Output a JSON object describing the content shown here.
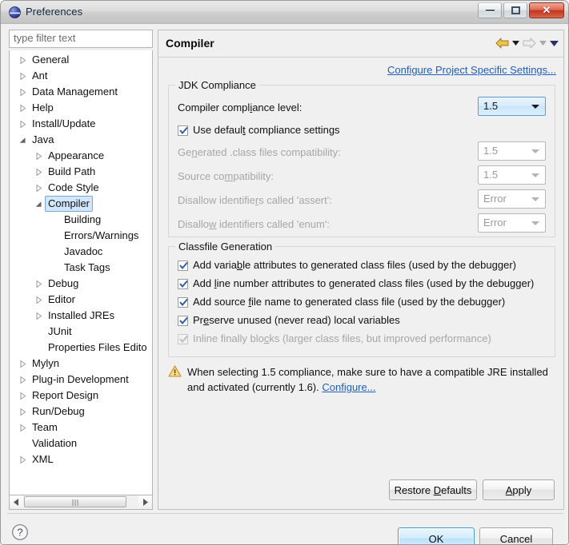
{
  "window": {
    "title": "Preferences",
    "icon": "eclipse-sphere-icon",
    "controls": {
      "minimize": "Minimize",
      "maximize": "Maximize",
      "close": "Close"
    }
  },
  "sidebar": {
    "filter": {
      "placeholder": "type filter text",
      "value": ""
    },
    "items": [
      {
        "label": "General",
        "depth": 0,
        "twisty": "collapsed",
        "selected": false
      },
      {
        "label": "Ant",
        "depth": 0,
        "twisty": "collapsed",
        "selected": false
      },
      {
        "label": "Data Management",
        "depth": 0,
        "twisty": "collapsed",
        "selected": false
      },
      {
        "label": "Help",
        "depth": 0,
        "twisty": "collapsed",
        "selected": false
      },
      {
        "label": "Install/Update",
        "depth": 0,
        "twisty": "collapsed",
        "selected": false
      },
      {
        "label": "Java",
        "depth": 0,
        "twisty": "expanded",
        "selected": false
      },
      {
        "label": "Appearance",
        "depth": 1,
        "twisty": "collapsed",
        "selected": false
      },
      {
        "label": "Build Path",
        "depth": 1,
        "twisty": "collapsed",
        "selected": false
      },
      {
        "label": "Code Style",
        "depth": 1,
        "twisty": "collapsed",
        "selected": false
      },
      {
        "label": "Compiler",
        "depth": 1,
        "twisty": "expanded",
        "selected": true
      },
      {
        "label": "Building",
        "depth": 2,
        "twisty": "none",
        "selected": false
      },
      {
        "label": "Errors/Warnings",
        "depth": 2,
        "twisty": "none",
        "selected": false
      },
      {
        "label": "Javadoc",
        "depth": 2,
        "twisty": "none",
        "selected": false
      },
      {
        "label": "Task Tags",
        "depth": 2,
        "twisty": "none",
        "selected": false
      },
      {
        "label": "Debug",
        "depth": 1,
        "twisty": "collapsed",
        "selected": false
      },
      {
        "label": "Editor",
        "depth": 1,
        "twisty": "collapsed",
        "selected": false
      },
      {
        "label": "Installed JREs",
        "depth": 1,
        "twisty": "collapsed",
        "selected": false
      },
      {
        "label": "JUnit",
        "depth": 1,
        "twisty": "none",
        "selected": false
      },
      {
        "label": "Properties Files Edito",
        "depth": 1,
        "twisty": "none",
        "selected": false
      },
      {
        "label": "Mylyn",
        "depth": 0,
        "twisty": "collapsed",
        "selected": false
      },
      {
        "label": "Plug-in Development",
        "depth": 0,
        "twisty": "collapsed",
        "selected": false
      },
      {
        "label": "Report Design",
        "depth": 0,
        "twisty": "collapsed",
        "selected": false
      },
      {
        "label": "Run/Debug",
        "depth": 0,
        "twisty": "collapsed",
        "selected": false
      },
      {
        "label": "Team",
        "depth": 0,
        "twisty": "collapsed",
        "selected": false
      },
      {
        "label": "Validation",
        "depth": 0,
        "twisty": "none",
        "selected": false
      },
      {
        "label": "XML",
        "depth": 0,
        "twisty": "collapsed",
        "selected": false
      }
    ]
  },
  "page": {
    "title": "Compiler",
    "nav": {
      "back": "back-arrow-icon",
      "back_menu": "back-history-dropdown-icon",
      "forward": "forward-arrow-icon",
      "forward_menu": "forward-history-dropdown-icon",
      "view_menu": "view-menu-dropdown-icon"
    },
    "project_settings_link": "Configure Project Specific Settings...",
    "jdk_group": {
      "legend": "JDK Compliance",
      "compliance_level": {
        "label": "Compiler compliance level:",
        "value": "1.5",
        "enabled": true
      },
      "use_defaults": {
        "label": "Use default compliance settings",
        "checked": true,
        "enabled": true
      },
      "rows": [
        {
          "label": "Generated .class files compatibility:",
          "value": "1.5",
          "enabled": false
        },
        {
          "label": "Source compatibility:",
          "value": "1.5",
          "enabled": false
        },
        {
          "label": "Disallow identifiers called 'assert':",
          "value": "Error",
          "enabled": false
        },
        {
          "label": "Disallow identifiers called 'enum':",
          "value": "Error",
          "enabled": false
        }
      ]
    },
    "classfile_group": {
      "legend": "Classfile Generation",
      "checkboxes": [
        {
          "label": "Add variable attributes to generated class files (used by the debugger)",
          "checked": true,
          "enabled": true
        },
        {
          "label": "Add line number attributes to generated class files (used by the debugger)",
          "checked": true,
          "enabled": true
        },
        {
          "label": "Add source file name to generated class file (used by the debugger)",
          "checked": true,
          "enabled": true
        },
        {
          "label": "Preserve unused (never read) local variables",
          "checked": true,
          "enabled": true
        },
        {
          "label": "Inline finally blocks (larger class files, but improved performance)",
          "checked": true,
          "enabled": false
        }
      ]
    },
    "warning": {
      "icon": "warning-triangle-icon",
      "text_before": "When selecting 1.5 compliance, make sure to have a compatible JRE installed and activated (currently 1.6). ",
      "link": "Configure..."
    },
    "buttons": {
      "restore_defaults": "Restore Defaults",
      "apply": "Apply"
    }
  },
  "footer": {
    "help_icon": "help-question-icon",
    "ok": "OK",
    "cancel": "Cancel"
  },
  "colors": {
    "accent_link": "#1f5fbe",
    "selection_fill": "#d3e7fb",
    "selection_border": "#7aa5d6",
    "focus_border": "#3c9bd4",
    "warning_amber": "#e8a33d",
    "close_red": "#c3341c",
    "disabled_text": "#a6a6a6"
  }
}
